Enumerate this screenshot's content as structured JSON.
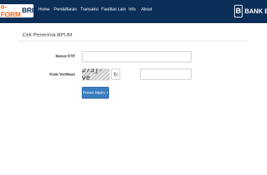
{
  "nav": {
    "brand_part1": "e-FORM",
    "brand_part2": "BRI",
    "items": [
      "Home",
      "Pendaftaran",
      "Transaksi",
      "Fasilitas Lain",
      "Info",
      "About"
    ],
    "bank_logo_text": "BANK B"
  },
  "form": {
    "title": "Cek Penerima BPUM",
    "ktp_label": "Nomor KTP",
    "ktp_value": "",
    "verif_label": "Kode Verifikasi",
    "captcha_text": "273j-ve",
    "verif_value": "",
    "submit_label": "Proses Inquiry",
    "submit_icon": "chevron-right-icon",
    "refresh_icon": "refresh-icon"
  },
  "colors": {
    "navbar": "#0c2f5a",
    "brand_orange": "#f26522",
    "button": "#3c7ec0"
  }
}
